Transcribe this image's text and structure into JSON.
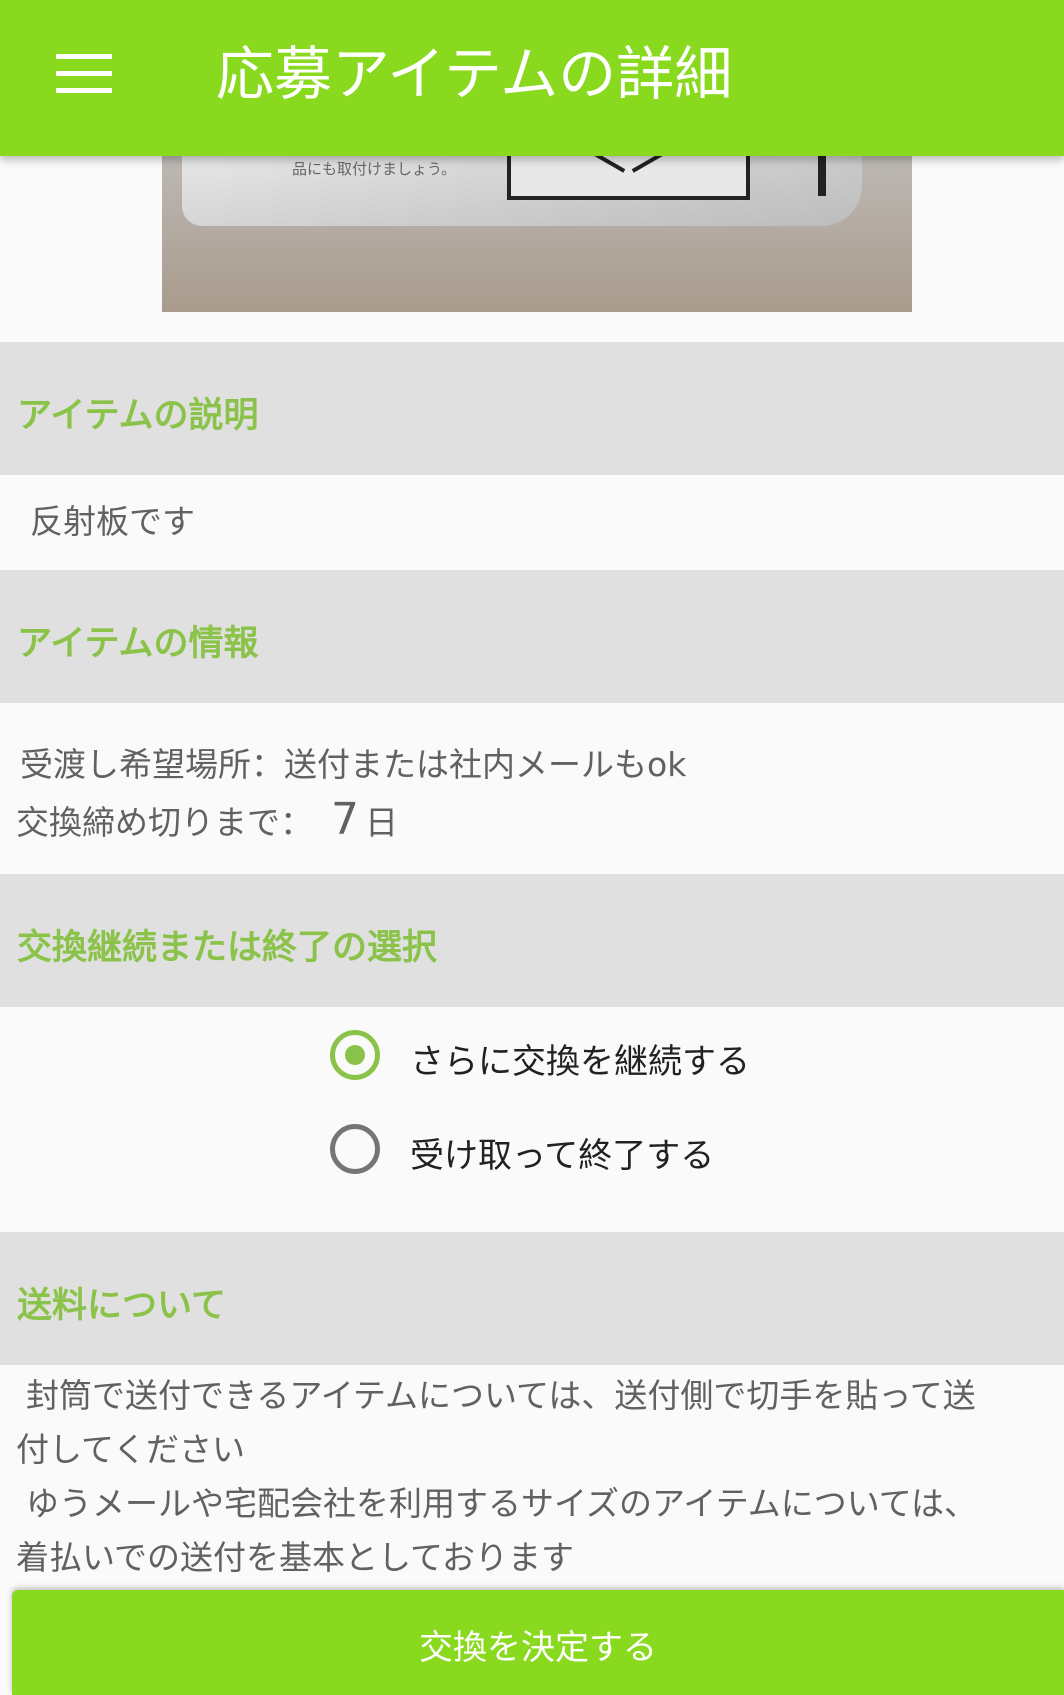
{
  "app_bar": {
    "title": "応募アイテムの詳細",
    "menu_icon": "hamburger-menu-icon"
  },
  "photo": {
    "label_text": "品にも取付けましょう。"
  },
  "description": {
    "header": "アイテムの説明",
    "text": "反射板です"
  },
  "info": {
    "header": "アイテムの情報",
    "place_label": "受渡し希望場所：",
    "place_value": "送付または社内メールもok",
    "deadline_label": "交換締め切りまで：",
    "deadline_days": "7",
    "deadline_unit": "日"
  },
  "choice": {
    "header": "交換継続または終了の選択",
    "options": [
      {
        "label": "さらに交換を継続する",
        "selected": true
      },
      {
        "label": "受け取って終了する",
        "selected": false
      }
    ]
  },
  "shipping": {
    "header": "送料について",
    "lines": [
      "封筒で送付できるアイテムについては、送付側で切手を貼って送",
      "付してください",
      "ゆうメールや宅配会社を利用するサイズのアイテムについては、",
      "着払いでの送付を基本としております"
    ]
  },
  "submit": {
    "label": "交換を決定する"
  },
  "colors": {
    "app_bar": "#89d91f",
    "accent_green": "#8bc34a",
    "section_bg": "#e0e0e0",
    "page_bg": "#fafafa",
    "radio_unchecked": "#757575"
  }
}
